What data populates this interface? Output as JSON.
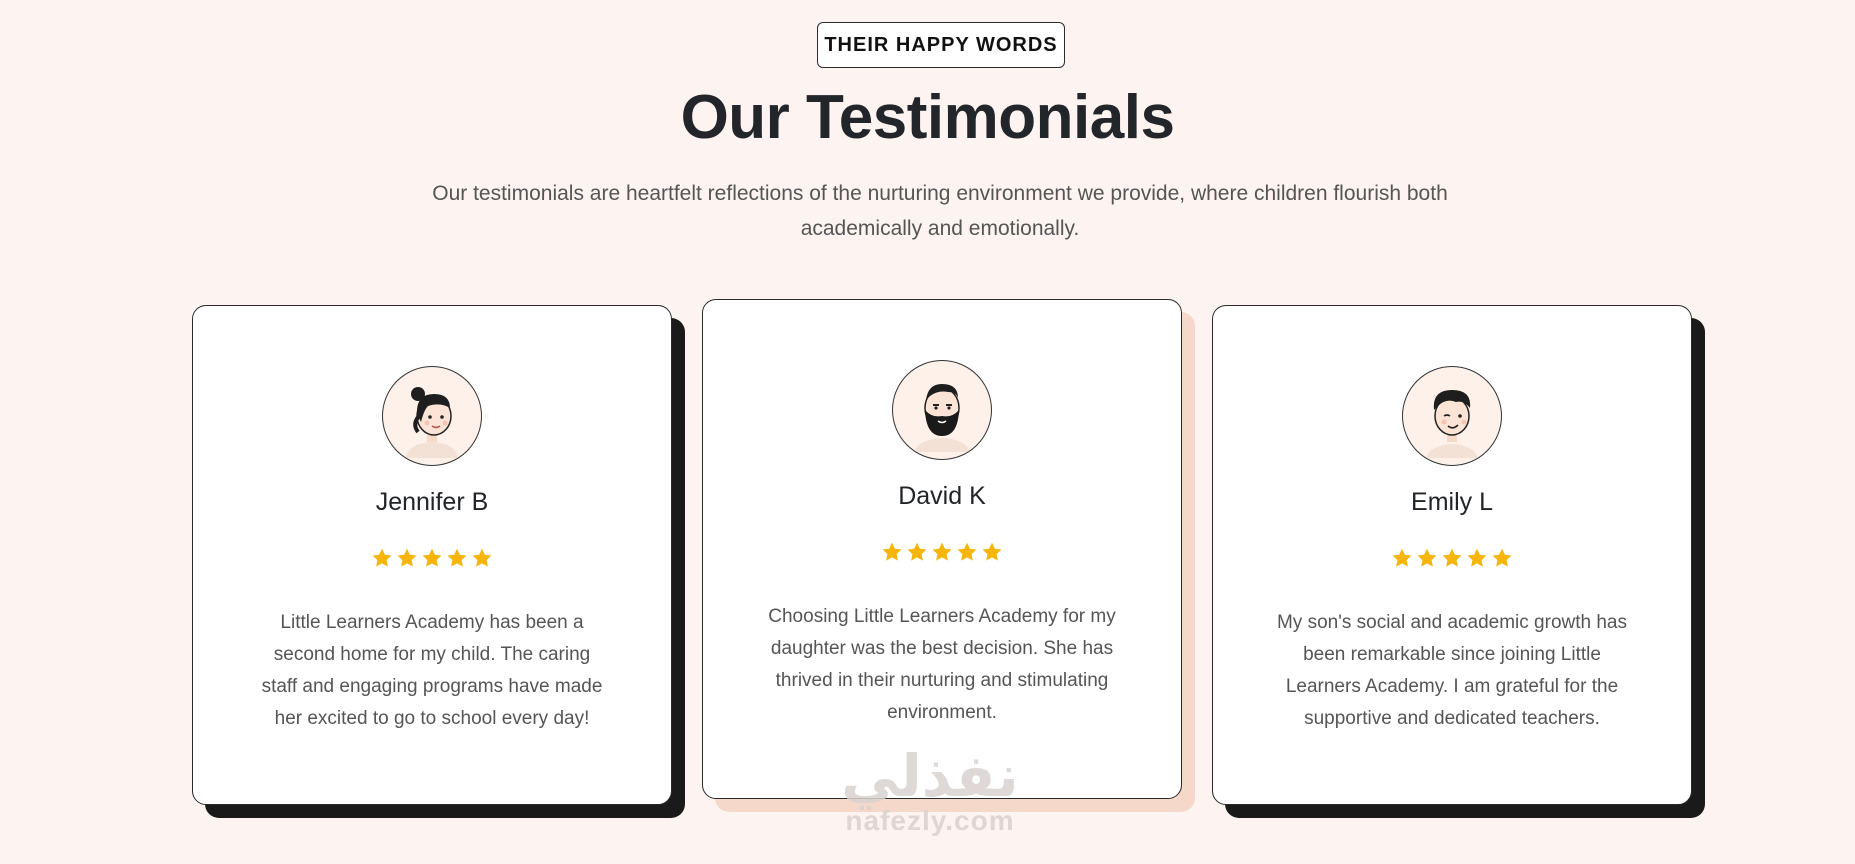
{
  "header": {
    "eyebrow": "THEIR HAPPY WORDS",
    "title": "Our Testimonials",
    "subtitle_line1": "Our testimonials are heartfelt reflections of the nurturing environment we provide, where children flourish both",
    "subtitle_line2": "academically and emotionally."
  },
  "colors": {
    "background": "#fdf3f0",
    "card": "#ffffff",
    "star": "#f5b50a",
    "shadow_dark": "#1a1a1a",
    "shadow_peach": "#f5d8ca"
  },
  "testimonials": [
    {
      "name": "Jennifer B",
      "rating": 5,
      "avatar_icon": "woman-avatar-icon",
      "quote_lines": [
        "Little Learners Academy has been a",
        "second home for my child. The caring",
        "staff and engaging programs have made",
        "her excited to go to school every day!"
      ]
    },
    {
      "name": "David K",
      "rating": 5,
      "avatar_icon": "bearded-man-avatar-icon",
      "quote_lines": [
        "Choosing Little Learners Academy for my",
        "daughter was the best decision. She has",
        "thrived in their nurturing and stimulating",
        "environment."
      ]
    },
    {
      "name": "Emily L",
      "rating": 5,
      "avatar_icon": "young-man-avatar-icon",
      "quote_lines": [
        "My son's social and academic growth has",
        "been remarkable since joining Little",
        "Learners Academy. I am grateful for the",
        "supportive and dedicated teachers."
      ]
    }
  ],
  "watermark": {
    "arabic": "نفذلي",
    "latin": "nafezly.com"
  }
}
